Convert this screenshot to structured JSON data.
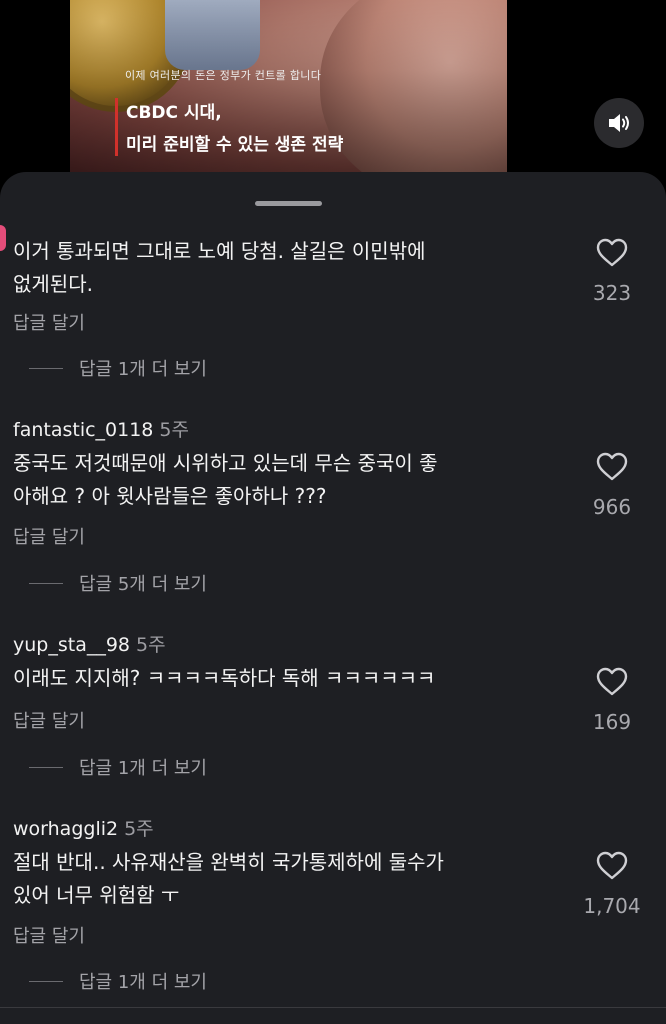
{
  "video": {
    "subtitle": "이제 여러분의 돈은 정부가 컨트롤 합니다",
    "headline_line1": "CBDC 시대,",
    "headline_line2": "미리 준비할 수 있는 생존 전략",
    "mute_icon": "speaker-icon"
  },
  "colors": {
    "sheet_bg": "#1e1f23",
    "accent_red": "#d1312b",
    "muted_text": "#a3a3a8"
  },
  "comments": [
    {
      "user": "",
      "time": "",
      "text_line1": "이거 통과되면 그대로 노예 당첨. 살길은 이민밖에",
      "text_line2": "없게된다.",
      "reply_label": "답글 달기",
      "more_replies": "답글 1개 더 보기",
      "likes": "323"
    },
    {
      "user": "fantastic_0118",
      "time": "5주",
      "text_line1": "중국도 저것때문애 시위하고 있는데 무슨 중국이 좋",
      "text_line2": "아해요 ? 아 윗사람들은 좋아하나 ???",
      "reply_label": "답글 달기",
      "more_replies": "답글 5개 더 보기",
      "likes": "966"
    },
    {
      "user": "yup_sta__98",
      "time": "5주",
      "text_line1": "이래도 지지해? ㅋㅋㅋㅋ독하다 독해 ㅋㅋㅋㅋㅋㅋ",
      "text_line2": "",
      "reply_label": "답글 달기",
      "more_replies": "답글 1개 더 보기",
      "likes": "169"
    },
    {
      "user": "worhaggli2",
      "time": "5주",
      "text_line1": "절대 반대.. 사유재산을 완벽히 국가통제하에 둘수가",
      "text_line2": "있어 너무 위험함 ㅜ",
      "reply_label": "답글 달기",
      "more_replies": "답글 1개 더 보기",
      "likes": "1,704"
    }
  ]
}
